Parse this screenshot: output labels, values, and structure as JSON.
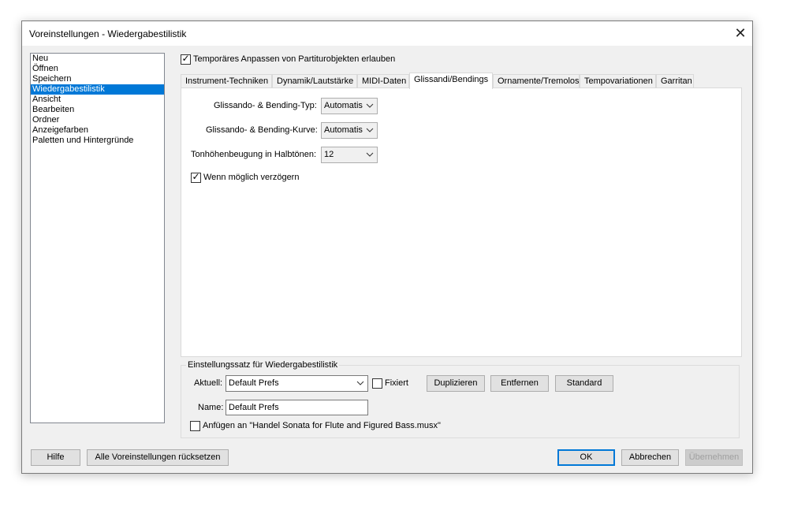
{
  "window": {
    "title": "Voreinstellungen - Wiedergabestilistik",
    "close_glyph": "✕"
  },
  "sidebar": {
    "items": [
      {
        "label": "Neu"
      },
      {
        "label": "Öffnen"
      },
      {
        "label": "Speichern"
      },
      {
        "label": "Wiedergabestilistik"
      },
      {
        "label": "Ansicht"
      },
      {
        "label": "Bearbeiten"
      },
      {
        "label": "Ordner"
      },
      {
        "label": "Anzeigefarben"
      },
      {
        "label": "Paletten und Hintergründe"
      }
    ],
    "selected": "Wiedergabestilistik"
  },
  "temp_adjust": {
    "label": "Temporäres Anpassen von Partiturobjekten erlauben",
    "checked": true
  },
  "tabs": [
    {
      "label": "Instrument-Techniken"
    },
    {
      "label": "Dynamik/Lautstärke"
    },
    {
      "label": "MIDI-Daten"
    },
    {
      "label": "Glissandi/Bendings"
    },
    {
      "label": "Ornamente/Tremolos"
    },
    {
      "label": "Tempovariationen"
    },
    {
      "label": "Garritan"
    }
  ],
  "active_tab": "Glissandi/Bendings",
  "glissandi": {
    "type_label": "Glissando- & Bending-Typ:",
    "type_value": "Automatis",
    "curve_label": "Glissando- & Bending-Kurve:",
    "curve_value": "Automatis",
    "semitones_label": "Tonhöhenbeugung in Halbtönen:",
    "semitones_value": "12",
    "delay_label": "Wenn möglich verzögern",
    "delay_checked": true
  },
  "settings_set": {
    "legend": "Einstellungssatz für Wiedergabestilistik",
    "current_label": "Aktuell:",
    "current_value": "Default Prefs",
    "fixed_label": "Fixiert",
    "fixed_checked": false,
    "duplicate_label": "Duplizieren",
    "remove_label": "Entfernen",
    "standard_label": "Standard",
    "name_label": "Name:",
    "name_value": "Default Prefs",
    "append_label": "Anfügen an \"Handel Sonata for Flute and Figured Bass.musx\"",
    "append_checked": false
  },
  "footer": {
    "help_label": "Hilfe",
    "reset_all_label": "Alle Voreinstellungen rücksetzen",
    "ok_label": "OK",
    "cancel_label": "Abbrechen",
    "apply_label": "Übernehmen"
  },
  "colors": {
    "selection": "#0078d7",
    "dialog_bg": "#f0f0f0",
    "default_button_border": "#0078d7"
  }
}
